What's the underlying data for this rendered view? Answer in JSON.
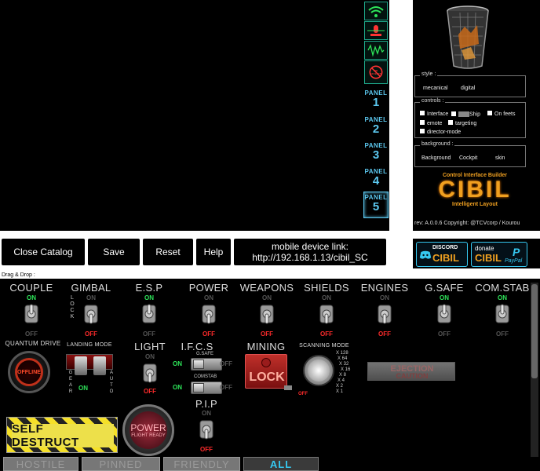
{
  "panel_column": {
    "icons": [
      "wifi-icon",
      "joystick-icon",
      "audio-icon",
      "no-effects-icon"
    ],
    "no_effects_label": "NO\nEFFECTS",
    "panel_label": "PANEL",
    "panels": [
      "1",
      "2",
      "3",
      "4",
      "5"
    ],
    "active_panel": "5"
  },
  "side": {
    "style": {
      "label": "style :",
      "options": [
        "mecanical",
        "digital"
      ]
    },
    "controls": {
      "label": "controls :",
      "options": [
        {
          "text": "Interface",
          "checked": false
        },
        {
          "text": "Ship",
          "checked": true
        },
        {
          "text": "On feets",
          "checked": false
        },
        {
          "text": "emote",
          "checked": false
        },
        {
          "text": "targeting",
          "checked": false
        },
        {
          "text": "director-mode",
          "checked": false
        }
      ]
    },
    "background": {
      "label": "background :",
      "options": [
        "Background",
        "Cockpit",
        "skin"
      ]
    },
    "logo": {
      "top": "Control Interface Builder",
      "name": "CIBIL",
      "bottom": "Intelligent Layout"
    },
    "copyright": "rev: A.0.0.6 Copyright: @TCVcorp / Kourou"
  },
  "buttons": {
    "close_catalog": "Close Catalog",
    "save": "Save",
    "reset": "Reset",
    "help": "Help",
    "mobile_link": "mobile device link:\nhttp://192.168.1.13/cibil_SC"
  },
  "links": {
    "discord": "DISCORD",
    "cibil": "CIBIL",
    "donate": "donate",
    "paypal": "PayPal"
  },
  "drag_drop": "Drag & Drop :",
  "switches": [
    {
      "title": "COUPLE",
      "on": "ON",
      "off": "OFF",
      "state": "on"
    },
    {
      "title": "GIMBAL",
      "on": "ON",
      "off": "OFF",
      "state": "off",
      "side": "LOCK"
    },
    {
      "title": "E.S.P",
      "on": "ON",
      "off": "OFF",
      "state": "on"
    },
    {
      "title": "POWER",
      "on": "ON",
      "off": "OFF",
      "state": "off"
    },
    {
      "title": "WEAPONS",
      "on": "ON",
      "off": "OFF",
      "state": "off"
    },
    {
      "title": "SHIELDS",
      "on": "ON",
      "off": "OFF",
      "state": "off"
    },
    {
      "title": "ENGINES",
      "on": "ON",
      "off": "OFF",
      "state": "off"
    },
    {
      "title": "G.SAFE",
      "on": "ON",
      "off": "OFF",
      "state": "on"
    },
    {
      "title": "COM.STAB",
      "on": "ON",
      "off": "OFF",
      "state": "on"
    }
  ],
  "row2": {
    "quantum": {
      "title": "QUANTUM DRIVE",
      "state": "OFFLINE"
    },
    "landing": {
      "title": "LANDING MODE",
      "gear": "GEAR",
      "auto": "AUTO",
      "on": "ON"
    },
    "light": {
      "title": "LIGHT",
      "on": "ON",
      "off": "OFF"
    },
    "ifcs": {
      "title": "I.F.C.S",
      "gsafe": "G.SAFE",
      "comstab": "COMSTAB",
      "on": "ON",
      "off": "OFF"
    },
    "mining": {
      "title": "MINING",
      "lock": "LOCK"
    },
    "scanning": {
      "title": "SCANNING  MODE",
      "levels": [
        "X 128",
        "X 64",
        "X 32",
        "X 16",
        "X 8",
        "X 4",
        "X 2",
        "X 1"
      ],
      "off": "OFF"
    },
    "ejection": {
      "label": "EJECTION",
      "caution": "CAUTION"
    },
    "pip": {
      "title": "P.I.P",
      "on": "ON",
      "off": "OFF"
    }
  },
  "self_destruct": "SELF DESTRUCT",
  "power_button": {
    "label": "POWER",
    "sub": "FLIGHT READY"
  },
  "filters": [
    "HOSTILE",
    "PINNED",
    "FRIENDLY",
    "ALL"
  ],
  "colors": {
    "on": "#2ee65a",
    "off": "#ff2b2b",
    "panel": "#5cc8f0",
    "accent": "#f0a020",
    "cyan": "#36c8f0"
  }
}
